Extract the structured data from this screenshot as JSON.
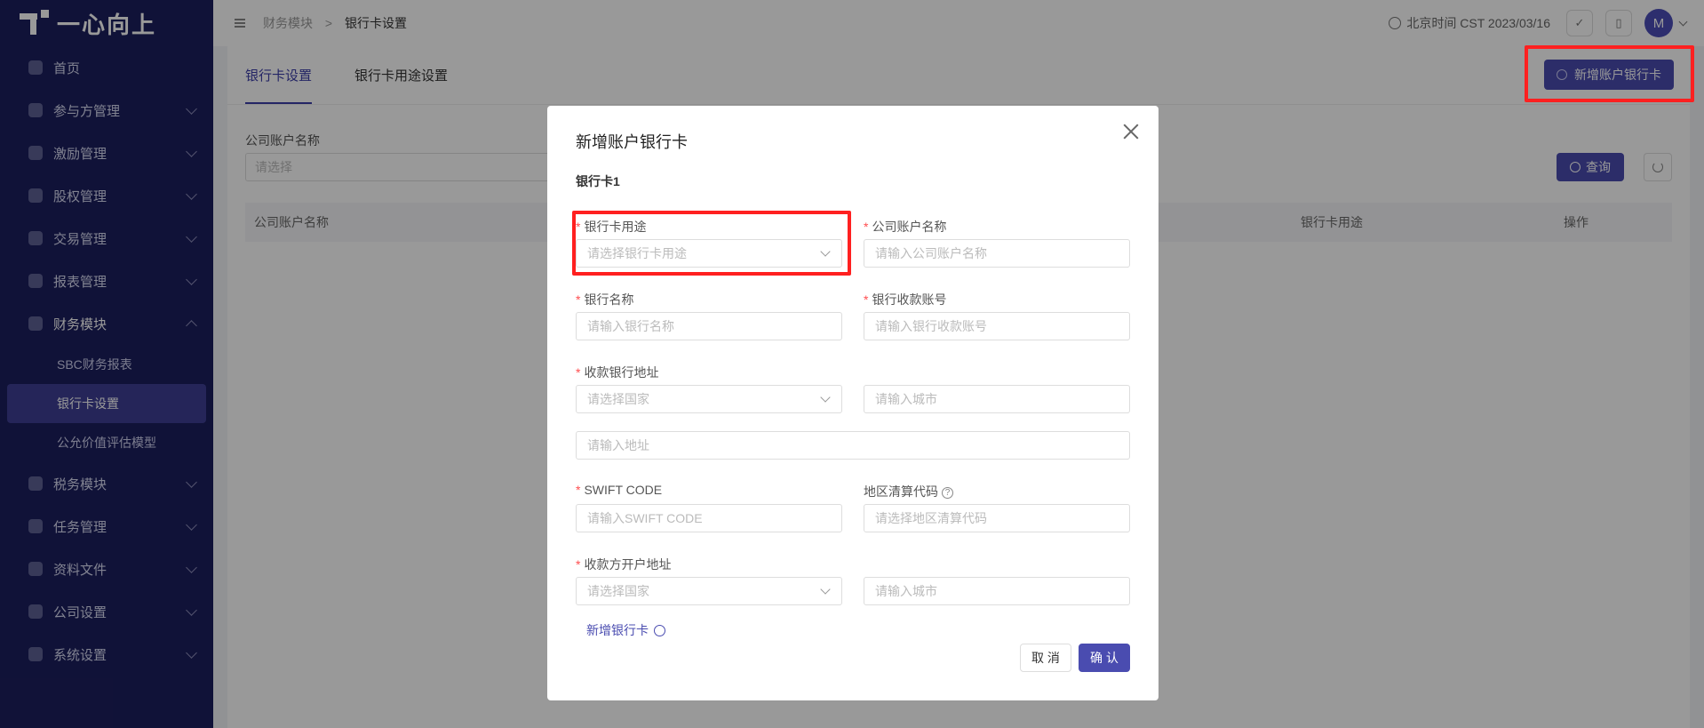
{
  "app": {
    "brand": "一心向上"
  },
  "sidebar": {
    "items": [
      {
        "label": "首页",
        "icon": "home-icon"
      },
      {
        "label": "参与方管理",
        "icon": "participants-icon"
      },
      {
        "label": "激励管理",
        "icon": "incentive-icon"
      },
      {
        "label": "股权管理",
        "icon": "equity-icon"
      },
      {
        "label": "交易管理",
        "icon": "trade-icon"
      },
      {
        "label": "报表管理",
        "icon": "report-icon"
      },
      {
        "label": "财务模块",
        "icon": "finance-icon"
      },
      {
        "label": "税务模块",
        "icon": "tax-icon"
      },
      {
        "label": "任务管理",
        "icon": "task-icon"
      },
      {
        "label": "资料文件",
        "icon": "files-icon"
      },
      {
        "label": "公司设置",
        "icon": "company-icon"
      },
      {
        "label": "系统设置",
        "icon": "settings-icon"
      }
    ],
    "finance_sub": [
      "SBC财务报表",
      "银行卡设置",
      "公允价值评估模型"
    ]
  },
  "header": {
    "breadcrumb": [
      "财务模块",
      "银行卡设置"
    ],
    "breadcrumb_sep": ">",
    "time": "北京时间 CST 2023/03/16",
    "avatar": "M"
  },
  "main": {
    "tabs": [
      "银行卡设置",
      "银行卡用途设置"
    ],
    "add_button": "新增账户银行卡",
    "filter_label": "公司账户名称",
    "filter_placeholder": "请选择",
    "query_button": "查询",
    "table_headers": [
      "公司账户名称",
      "银行卡用途",
      "操作"
    ]
  },
  "modal": {
    "title": "新增账户银行卡",
    "section": "银行卡1",
    "fields": {
      "purpose_label": "银行卡用途",
      "purpose_ph": "请选择银行卡用途",
      "company_label": "公司账户名称",
      "company_ph": "请输入公司账户名称",
      "bank_label": "银行名称",
      "bank_ph": "请输入银行名称",
      "account_label": "银行收款账号",
      "account_ph": "请输入银行收款账号",
      "bank_addr_label": "收款银行地址",
      "country_ph": "请选择国家",
      "city_ph": "请输入城市",
      "addr_ph": "请输入地址",
      "swift_label": "SWIFT CODE",
      "swift_ph": "请输入SWIFT CODE",
      "region_label": "地区清算代码",
      "region_ph": "请选择地区清算代码",
      "payee_addr_label": "收款方开户地址",
      "payee_country_ph": "请选择国家",
      "payee_city_ph": "请输入城市"
    },
    "add_bank": "新增银行卡",
    "cancel": "取 消",
    "confirm": "确 认"
  }
}
